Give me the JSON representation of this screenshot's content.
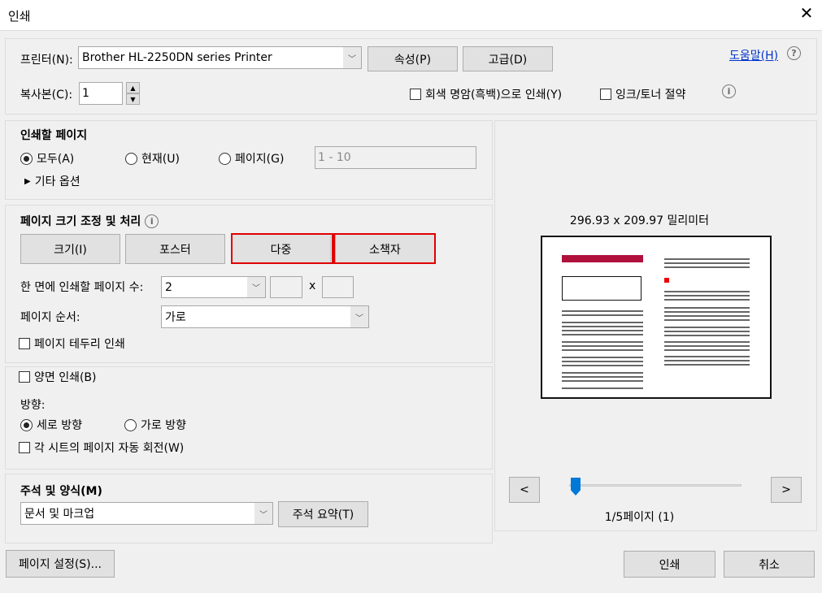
{
  "window": {
    "title": "인쇄",
    "close_icon": "close-icon"
  },
  "printer": {
    "label": "프린터(N):",
    "value": "Brother HL-2250DN series Printer",
    "properties": "속성(P)",
    "advanced": "고급(D)",
    "help": "도움말(H)",
    "help_icon": "question-circle-icon"
  },
  "copies": {
    "label": "복사본(C):",
    "value": "1",
    "grayscale": "회색 명암(흑백)으로 인쇄(Y)",
    "grayscale_checked": false,
    "save_ink": "잉크/토너 절약",
    "save_ink_checked": false
  },
  "pages": {
    "title": "인쇄할 페이지",
    "all": "모두(A)",
    "current": "현재(U)",
    "pages": "페이지(G)",
    "selected": "all",
    "range_placeholder": "1 - 10",
    "more": "기타 옵션"
  },
  "sizing": {
    "title": "페이지 크기 조정 및 처리",
    "buttons": [
      "크기(I)",
      "포스터",
      "다중",
      "소책자"
    ],
    "active": "다중",
    "per_sheet_label": "한 면에 인쇄할 페이지 수:",
    "per_sheet": "2",
    "x": "x",
    "order_label": "페이지 순서:",
    "order": "가로",
    "border": "페이지 테두리 인쇄",
    "border_checked": false
  },
  "duplex": {
    "label": "양면 인쇄(B)",
    "checked": false,
    "orientation_label": "방향:",
    "portrait": "세로 방향",
    "landscape": "가로 방향",
    "selected": "portrait",
    "auto_rotate": "각 시트의 페이지 자동 회전(W)",
    "auto_rotate_checked": false
  },
  "comments": {
    "title": "주석 및 양식(M)",
    "value": "문서 및 마크업",
    "summary": "주석 요약(T)"
  },
  "preview": {
    "dimensions": "296.93 x 209.97 밀리미터",
    "prev": "<",
    "next": ">",
    "page": "1/5페이지 (1)",
    "slider_value": 1,
    "slider_max": 5
  },
  "footer": {
    "page_setup": "페이지 설정(S)...",
    "print": "인쇄",
    "cancel": "취소"
  },
  "colors": {
    "highlight": "#e00000",
    "link": "#0033cc",
    "thumb": "#0078d7"
  }
}
